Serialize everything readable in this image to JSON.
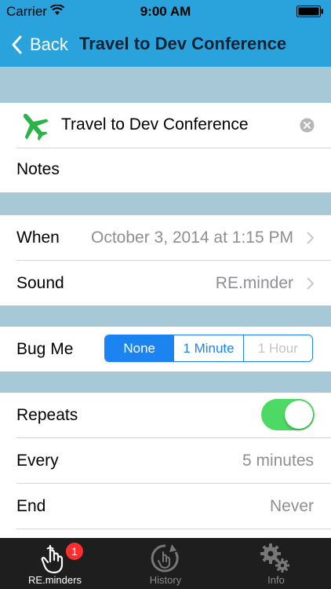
{
  "status": {
    "carrier": "Carrier",
    "time": "9:00 AM"
  },
  "nav": {
    "back_label": "Back",
    "title": "Travel to Dev Conference"
  },
  "reminder": {
    "title": "Travel to Dev Conference",
    "notes_placeholder": "Notes",
    "icon": "airplane-icon"
  },
  "when": {
    "label": "When",
    "value": "October 3, 2014 at 1:15 PM"
  },
  "sound": {
    "label": "Sound",
    "value": "RE.minder"
  },
  "bugme": {
    "label": "Bug Me",
    "options": [
      "None",
      "1 Minute",
      "1 Hour"
    ],
    "selected": "None"
  },
  "repeats": {
    "label": "Repeats",
    "on": true
  },
  "every": {
    "label": "Every",
    "value": "5 minutes"
  },
  "end": {
    "label": "End",
    "value": "Never"
  },
  "tabs": [
    {
      "label": "RE.minders",
      "badge": "1",
      "active": true
    },
    {
      "label": "History",
      "active": false
    },
    {
      "label": "Info",
      "active": false
    }
  ],
  "colors": {
    "nav": "#2aa3dd",
    "accent": "#1c84f0",
    "toggle_on": "#4cd964",
    "airplane": "#2bb34a",
    "badge": "#ff2d2d"
  }
}
